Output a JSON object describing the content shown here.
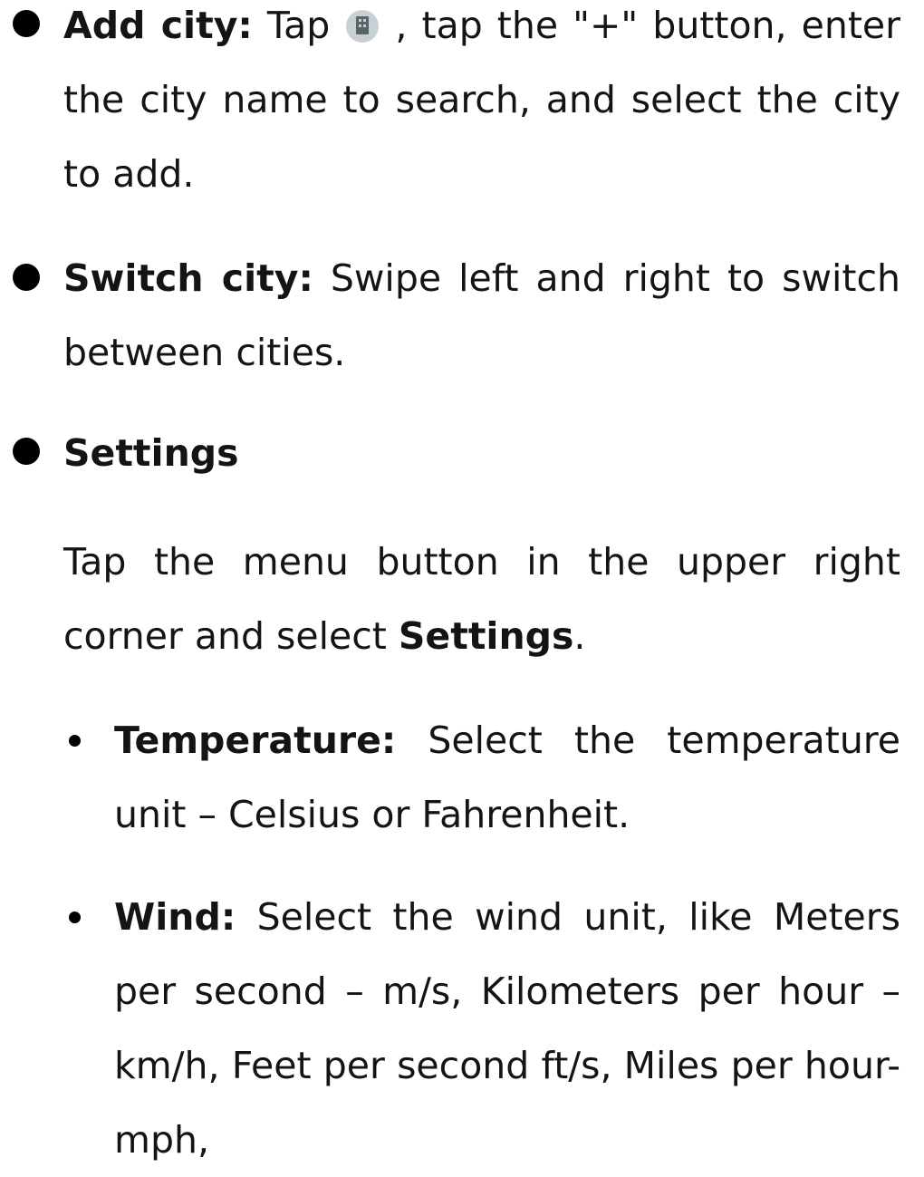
{
  "sections": {
    "add_city": {
      "title": "Add city:",
      "text_before_icon": " Tap ",
      "icon": "city-management-icon",
      "text_after_icon": " , tap the \"+\" button, enter the city name to search, and select the city to add."
    },
    "switch_city": {
      "title": "Switch city:",
      "text": " Swipe left and right to switch between cities."
    },
    "settings": {
      "title": "Settings",
      "intro_before": "Tap the menu button in the upper right corner and select ",
      "intro_bold": "Settings",
      "intro_after": ".",
      "items": [
        {
          "title": "Temperature:",
          "text": " Select the temperature unit – Celsius or Fahrenheit."
        },
        {
          "title": "Wind:",
          "text": " Select the wind unit, like Meters per second – m/s, Kilometers per hour – km/h, Feet per second ft/s, Miles per hour- mph,"
        }
      ]
    }
  }
}
